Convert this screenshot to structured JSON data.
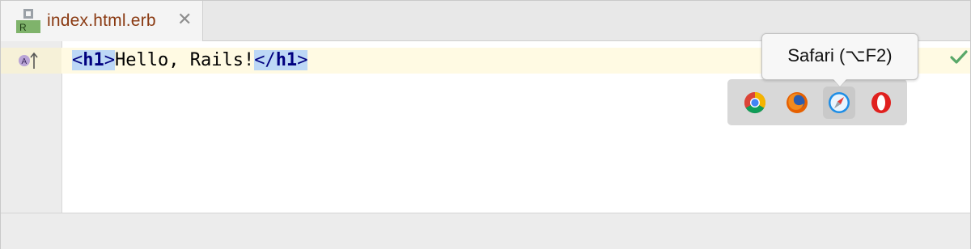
{
  "tab": {
    "filename": "index.html.erb",
    "file_icon_letter": "R",
    "close_glyph": "✕"
  },
  "code": {
    "open_lt": "<",
    "open_tag": "h1",
    "open_gt": ">",
    "text": "Hello, Rails!",
    "close_lt": "</",
    "close_tag": "h1",
    "close_gt": ">"
  },
  "gutter": {
    "marker_letter": "A"
  },
  "tooltip": {
    "text": "Safari (⌥F2)"
  },
  "browsers": [
    {
      "name": "Chrome",
      "icon": "chrome-icon"
    },
    {
      "name": "Firefox",
      "icon": "firefox-icon"
    },
    {
      "name": "Safari",
      "icon": "safari-icon",
      "active": true
    },
    {
      "name": "Opera",
      "icon": "opera-icon"
    }
  ],
  "colors": {
    "accent_check": "#59a869",
    "tag_highlight": "#bdd8f6",
    "current_line": "#fffae3",
    "filename": "#8a3a12"
  }
}
